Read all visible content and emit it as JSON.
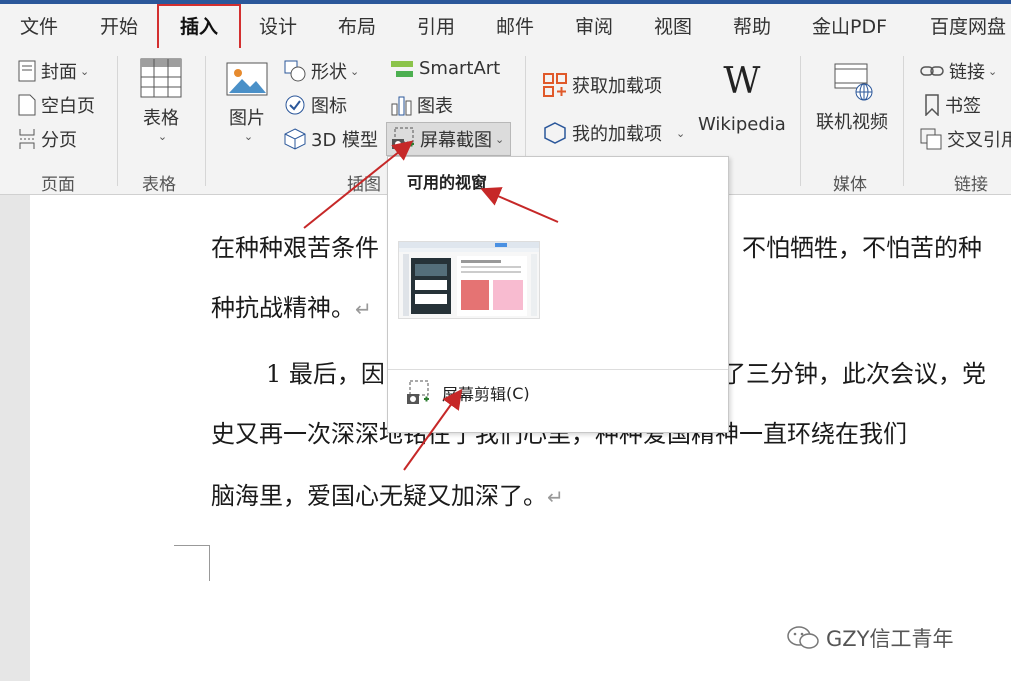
{
  "tabs": [
    "文件",
    "开始",
    "插入",
    "设计",
    "布局",
    "引用",
    "邮件",
    "审阅",
    "视图",
    "帮助",
    "金山PDF",
    "百度网盘"
  ],
  "ribbon": {
    "pages": {
      "cover": "封面",
      "blank_page": "空白页",
      "page_break": "分页",
      "label": "页面"
    },
    "tables": {
      "table": "表格",
      "label": "表格"
    },
    "illustrations": {
      "picture": "图片",
      "shapes": "形状",
      "icons": "图标",
      "model3d": "3D 模型",
      "smartart": "SmartArt",
      "chart": "图表",
      "screenshot": "屏幕截图",
      "label": "插图"
    },
    "addins": {
      "get_addins": "获取加载项",
      "my_addins": "我的加载项",
      "wikipedia": "Wikipedia"
    },
    "media": {
      "online_video": "联机视频",
      "label": "媒体"
    },
    "links": {
      "link": "链接",
      "bookmark": "书签",
      "cross_ref": "交叉引用",
      "label": "链接"
    }
  },
  "dropdown": {
    "header": "可用的视窗",
    "clip_label": "屏幕剪辑",
    "clip_shortcut": "(C)"
  },
  "document": {
    "line1a": "在种种艰苦条件",
    "line1b": "不怕牺牲，不怕苦的种",
    "line2": "种抗战精神。",
    "line3a": "1 最后，因",
    "line3b": "了三分钟，此次会议，党",
    "line4": "史又再一次深深地铭在了我们心里，种种爱国精神一直环绕在我们",
    "line5": "脑海里，爱国心无疑又加深了。"
  },
  "watermark": "GZY信工青年",
  "colors": {
    "accent": "#2b579a",
    "highlight": "#d32f2f",
    "arrow": "#c62828"
  }
}
